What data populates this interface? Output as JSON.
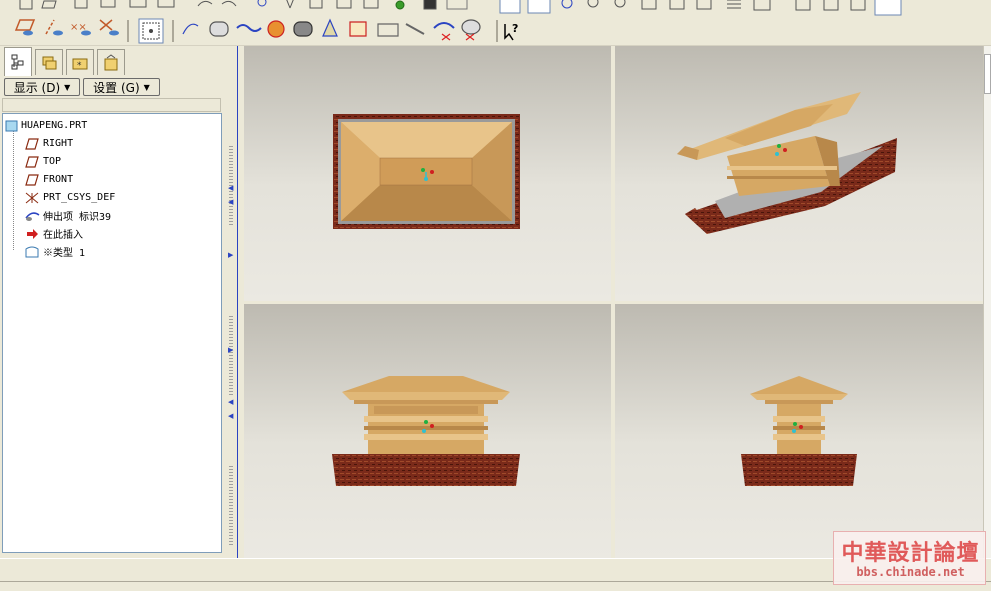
{
  "toolbar_top": {
    "icons": [
      "new-icon",
      "open-icon",
      "save-icon",
      "print-icon",
      "send-icon",
      "paste-special-icon",
      "undo-icon",
      "redo-icon",
      "regenerate-icon",
      "cut-icon",
      "copy-icon",
      "paste-icon",
      "paste-special-icon",
      "find-icon",
      "light-icon",
      "window-icon",
      "select-box-icon",
      "repaint-icon",
      "spin-center-icon",
      "orient-icon",
      "zoom-in-icon",
      "zoom-out-icon",
      "refit-icon",
      "reorient-icon",
      "saved-views-icon",
      "layers-icon",
      "view-manager-icon",
      "wireframe-icon",
      "hidden-line-icon",
      "no-hidden-icon",
      "shading-icon"
    ]
  },
  "toolbar_2": {
    "icons": [
      "datum-planes-icon",
      "datum-axes-icon",
      "datum-points-icon",
      "coordinate-systems-icon",
      "spin-display-icon",
      "sketch-icon",
      "datum-axis-tool-icon",
      "curve-tool-icon",
      "plane-tool-icon",
      "mirror-icon",
      "draft-icon",
      "round-icon",
      "chamfer-icon",
      "surface-icon",
      "shell-icon",
      "rib-icon",
      "extrude-cut-icon",
      "revolve-cut-icon",
      "whats-this-icon"
    ]
  },
  "left_panel": {
    "tabs": [
      "model-tree-tab",
      "layers-tab",
      "favorites-tab",
      "connections-tab"
    ],
    "show_button": "显示 (D)",
    "settings_button": "设置 (G)",
    "tree": [
      {
        "label": "HUAPENG.PRT",
        "icon": "part-icon"
      },
      {
        "label": "RIGHT",
        "icon": "datum-plane-icon"
      },
      {
        "label": "TOP",
        "icon": "datum-plane-icon"
      },
      {
        "label": "FRONT",
        "icon": "datum-plane-icon"
      },
      {
        "label": "PRT_CSYS_DEF",
        "icon": "csys-icon"
      },
      {
        "label": "伸出项 标识39",
        "icon": "protrusion-icon"
      },
      {
        "label": "在此插入",
        "icon": "insert-here-icon"
      },
      {
        "label": "※类型 1",
        "icon": "feature-type-icon"
      }
    ]
  },
  "viewports": [
    "top-view",
    "isometric-view",
    "front-view",
    "side-view"
  ],
  "watermark": {
    "title": "中華設計論壇",
    "url": "bbs.chinade.net"
  },
  "colors": {
    "wood": "#d3a867",
    "wood_light": "#e8c48a",
    "frame": "#7a2a1a",
    "accent": "#2b44c2"
  }
}
